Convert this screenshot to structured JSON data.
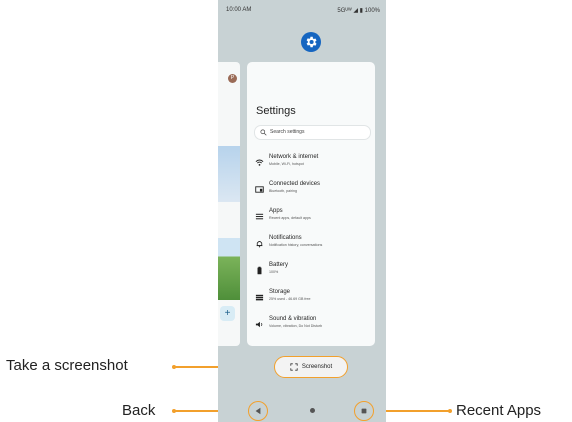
{
  "status_bar": {
    "time": "10:00 AM",
    "indicators": "5Gᵁᵂ ◢ ▮ 100%"
  },
  "icons": {
    "settings_app": "gear-icon",
    "back": "back-triangle-icon",
    "home": "home-dot-icon",
    "recents": "recents-square-icon",
    "screenshot": "screenshot-frame-icon"
  },
  "colors": {
    "accent": "#f2a02c",
    "settings_icon": "#1565c0"
  },
  "left_card": {
    "avatar_letter": "P",
    "fab_label": "+"
  },
  "settings": {
    "title": "Settings",
    "search_placeholder": "Search settings",
    "items": [
      {
        "title": "Network & internet",
        "subtitle": "Mobile, Wi-Fi, hotspot",
        "icon": "wifi-icon"
      },
      {
        "title": "Connected devices",
        "subtitle": "Bluetooth, pairing",
        "icon": "devices-icon"
      },
      {
        "title": "Apps",
        "subtitle": "Recent apps, default apps",
        "icon": "apps-icon"
      },
      {
        "title": "Notifications",
        "subtitle": "Notification history, conversations",
        "icon": "bell-icon"
      },
      {
        "title": "Battery",
        "subtitle": "100%",
        "icon": "battery-icon"
      },
      {
        "title": "Storage",
        "subtitle": "25% used - 46.69 GB free",
        "icon": "storage-icon"
      },
      {
        "title": "Sound & vibration",
        "subtitle": "Volume, vibration, Do Not Disturb",
        "icon": "sound-icon"
      }
    ]
  },
  "screenshot_button": {
    "label": "Screenshot"
  },
  "callouts": {
    "screenshot": "Take a screenshot",
    "back": "Back",
    "recents": "Recent Apps"
  }
}
